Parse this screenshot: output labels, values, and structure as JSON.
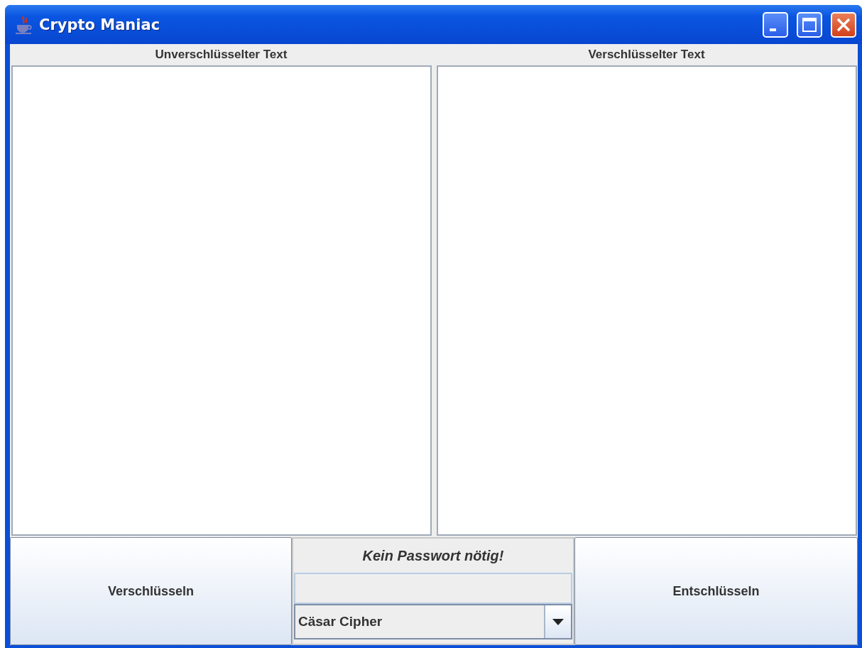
{
  "window": {
    "title": "Crypto Maniac"
  },
  "panes": [
    {
      "heading": "Unverschlüsselter Text"
    },
    {
      "heading": "Verschlüsselter Text"
    }
  ],
  "encrypt_button": {
    "label": "Verschlüsseln"
  },
  "password": {
    "label": "Kein Passwort nötig!",
    "disabled": true
  },
  "cipher_select": {
    "value": "Cäsar Cipher"
  },
  "decrypt_button": {
    "label": "Entschlüsseln"
  }
}
